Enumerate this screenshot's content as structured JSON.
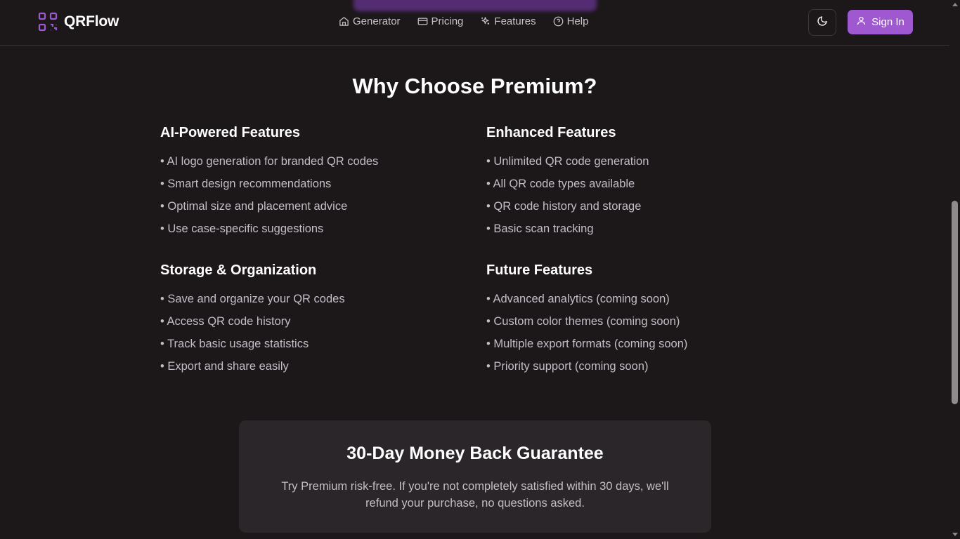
{
  "header": {
    "brand": "QRFlow",
    "nav": [
      {
        "label": "Generator",
        "icon": "home-icon"
      },
      {
        "label": "Pricing",
        "icon": "credit-card-icon"
      },
      {
        "label": "Features",
        "icon": "sparkles-icon"
      },
      {
        "label": "Help",
        "icon": "help-circle-icon"
      }
    ],
    "theme_toggle_icon": "moon-icon",
    "signin_label": "Sign In",
    "accent_color": "#a058d0"
  },
  "main": {
    "title": "Why Choose Premium?",
    "sections": [
      {
        "heading": "AI-Powered Features",
        "items": [
          "• AI logo generation for branded QR codes",
          "• Smart design recommendations",
          "• Optimal size and placement advice",
          "• Use case-specific suggestions"
        ]
      },
      {
        "heading": "Enhanced Features",
        "items": [
          "• Unlimited QR code generation",
          "• All QR code types available",
          "• QR code history and storage",
          "• Basic scan tracking"
        ]
      },
      {
        "heading": "Storage & Organization",
        "items": [
          "• Save and organize your QR codes",
          "• Access QR code history",
          "• Track basic usage statistics",
          "• Export and share easily"
        ]
      },
      {
        "heading": "Future Features",
        "items": [
          "• Advanced analytics (coming soon)",
          "• Custom color themes (coming soon)",
          "• Multiple export formats (coming soon)",
          "• Priority support (coming soon)"
        ]
      }
    ],
    "guarantee": {
      "title": "30-Day Money Back Guarantee",
      "text": "Try Premium risk-free. If you're not completely satisfied within 30 days, we'll refund your purchase, no questions asked."
    }
  }
}
